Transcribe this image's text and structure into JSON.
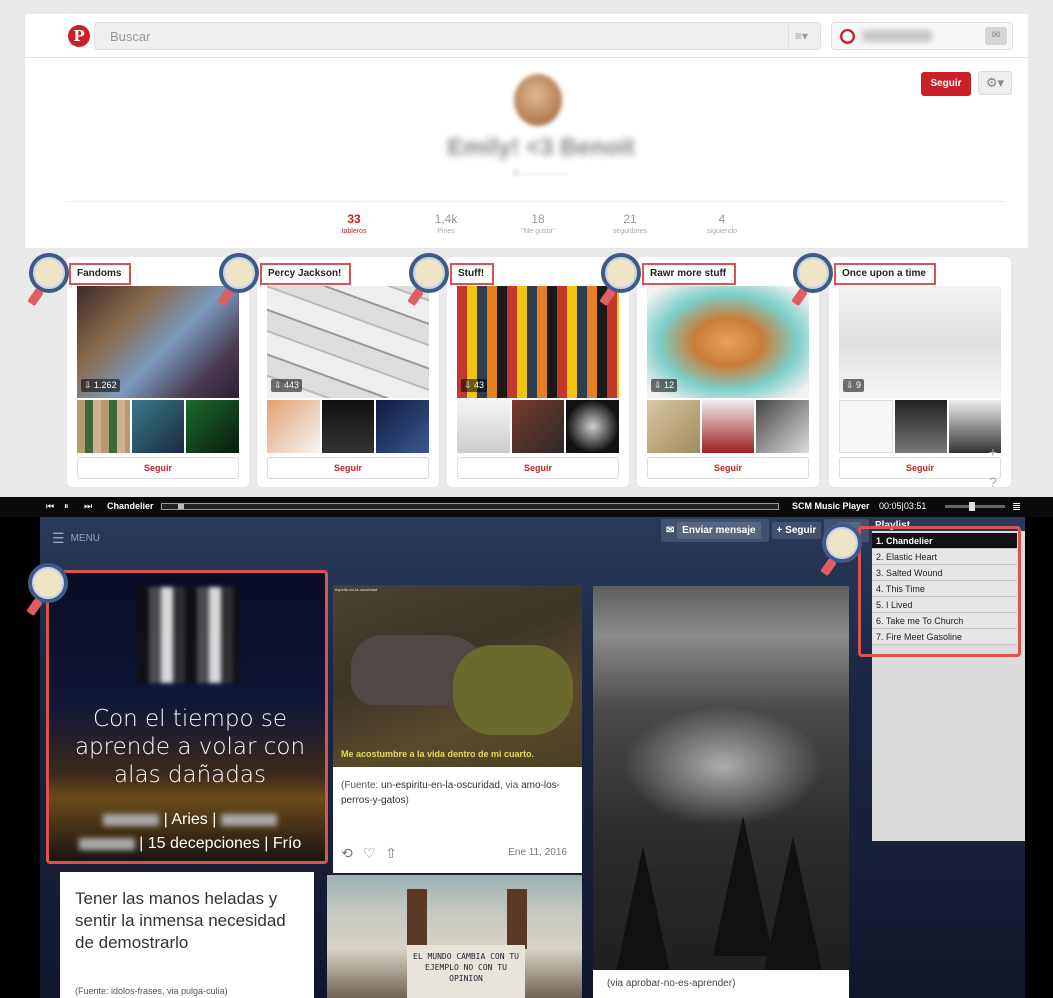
{
  "pinterest": {
    "search_placeholder": "Buscar",
    "logo": "P",
    "profile_name": "Emily! <3 Benoit",
    "follow_label": "Seguir",
    "stats": [
      {
        "value": "33",
        "label": "tableros"
      },
      {
        "value": "1,4k",
        "label": "Pines"
      },
      {
        "value": "18",
        "label": "\"Me gusta\""
      },
      {
        "value": "21",
        "label": "seguidores"
      },
      {
        "value": "4",
        "label": "siguiendo"
      }
    ],
    "boards": [
      {
        "title": "Fandoms",
        "pins": "1.262",
        "follow": "Seguir"
      },
      {
        "title": "Percy Jackson!",
        "pins": "443",
        "follow": "Seguir"
      },
      {
        "title": "Stuff!",
        "pins": "43",
        "follow": "Seguir"
      },
      {
        "title": "Rawr more stuff",
        "pins": "12",
        "follow": "Seguir"
      },
      {
        "title": "Once upon a time",
        "pins": "9",
        "follow": "Seguir"
      }
    ],
    "side_icons": [
      "+",
      "?"
    ]
  },
  "player": {
    "song": "Chandelier",
    "name": "SCM Music Player",
    "time": "00:05|03:51"
  },
  "tumblr": {
    "menu": "MENU",
    "message_btn": "Enviar mensaje",
    "follow_btn": "+ Seguir",
    "home_btn": "En",
    "playlist_title": "Playlist",
    "playlist": [
      "1. Chandelier",
      "2. Elastic Heart",
      "3. Salted Wound",
      "4. This Time",
      "5. I Lived",
      "6. Take me To Church",
      "7. Fire Meet Gasoline"
    ],
    "quote": "Con el tiempo se aprende a volar con alas dañadas",
    "info_line1": "| Aries |",
    "info_line2": "| 15 decepciones | Frío",
    "anime_caption": "Me acostumbre a la vida dentro de mi cuarto.",
    "anime_small": "espíritu-en-la-oscuridad",
    "anime_source_prefix": "(Fuente: ",
    "anime_source_link1": "un-espiritu-en-la-oscuridad",
    "anime_source_via": ", via ",
    "anime_source_link2": "amo-los-perros-y-gatos",
    "anime_source_suffix": ")",
    "anime_date": "Ene 11, 2016",
    "forest_source": "(via aprobar-no-es-aprender)",
    "text_post": "Tener las manos heladas y sentir la inmensa necesidad de demostrarlo",
    "text_source": "(Fuente: idolos-frases, via pulga-culia)",
    "graffiti": "EL MUNDO CAMBIA CON TU EJEMPLO NO CON TU OPINION"
  }
}
